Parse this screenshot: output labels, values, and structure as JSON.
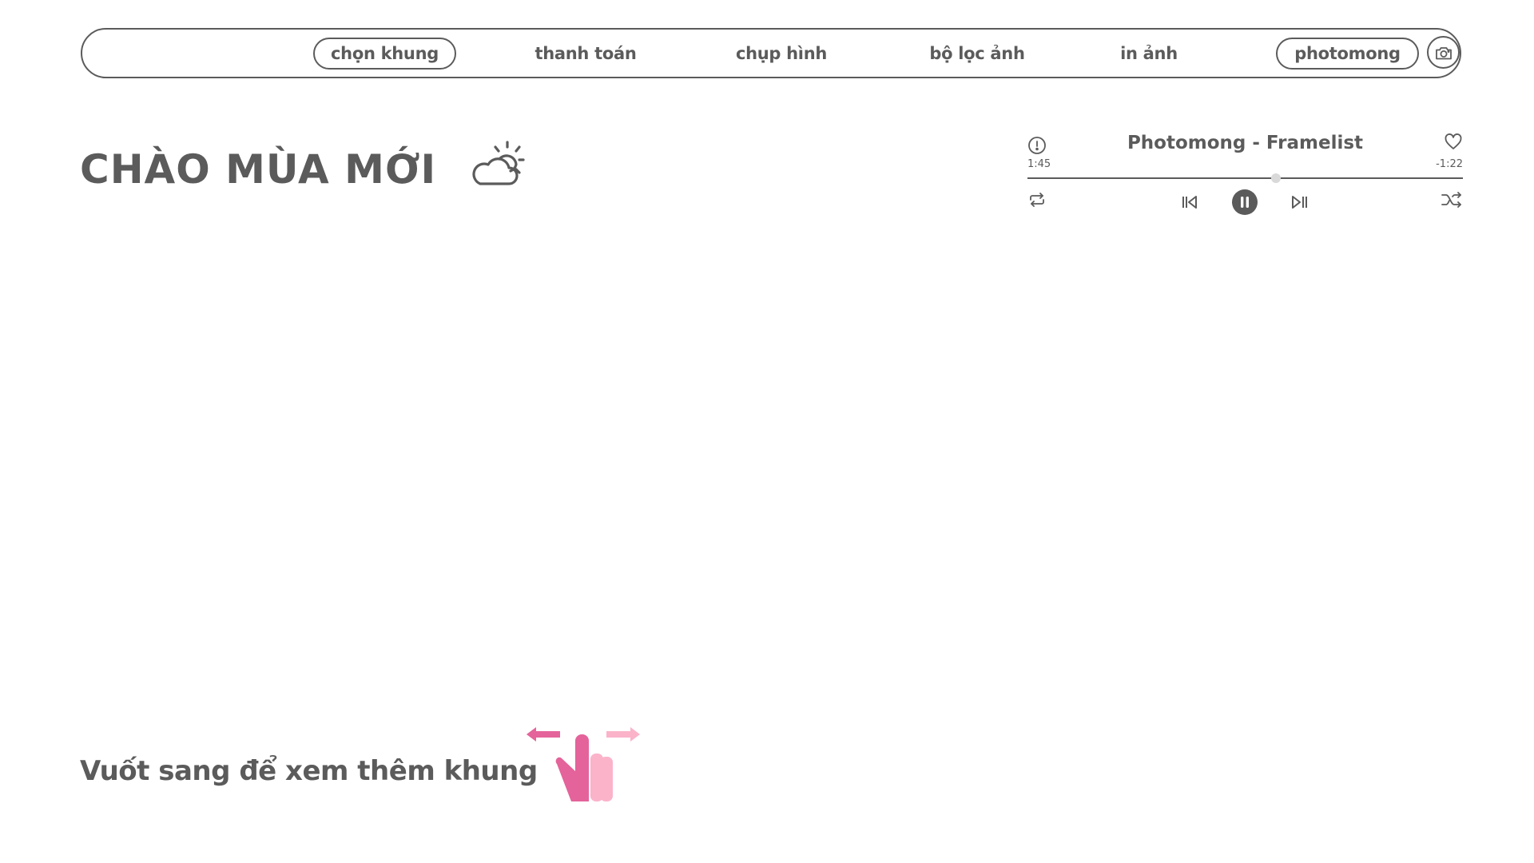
{
  "nav": {
    "items": [
      {
        "label": "chọn khung",
        "active": true
      },
      {
        "label": "thanh toán",
        "active": false
      },
      {
        "label": "chụp hình",
        "active": false
      },
      {
        "label": "bộ lọc ảnh",
        "active": false
      },
      {
        "label": "in ảnh",
        "active": false
      }
    ],
    "brand": "photomong",
    "camera_icon": "camera-icon"
  },
  "main": {
    "title": "CHÀO MÙA MỚI",
    "title_icon": "partly-cloudy-icon"
  },
  "player": {
    "song_title": "Photomong - Framelist",
    "elapsed": "1:45",
    "remaining": "-1:22",
    "progress": 0.57,
    "state": "playing",
    "icons": [
      "info-icon",
      "heart-icon",
      "repeat-icon",
      "previous-icon",
      "pause-icon",
      "next-icon",
      "shuffle-icon"
    ]
  },
  "footer": {
    "swipe_hint": "Vuốt sang để xem thêm khung",
    "swipe_icon": "swipe-hand-icon"
  },
  "colors": {
    "text": "#5b5b5b",
    "accent_pink": "#e4639a",
    "light_pink": "#fbb3ca",
    "knob": "#d9d9d9"
  }
}
